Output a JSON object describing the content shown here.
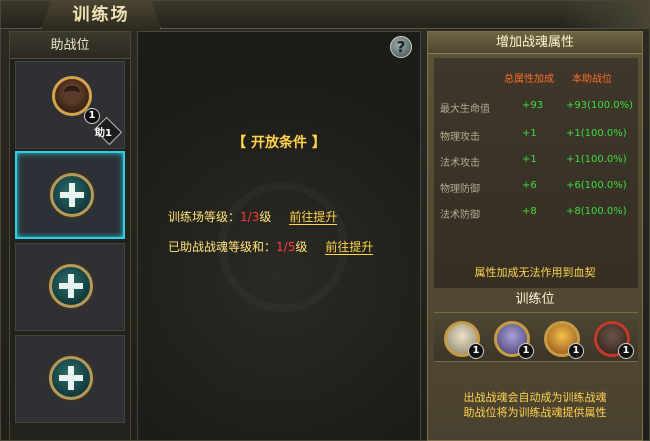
{
  "window": {
    "title": "训练场"
  },
  "left": {
    "header": "助战位",
    "slots": [
      {
        "type": "hero",
        "count": "1",
        "tag": "助1"
      },
      {
        "type": "empty"
      },
      {
        "type": "empty"
      },
      {
        "type": "empty"
      }
    ]
  },
  "middle": {
    "help_icon": "question-icon",
    "conditions_title": "【 开放条件 】",
    "rows": [
      {
        "label": "训练场等级：",
        "current": "1",
        "sep": "/",
        "required": "3",
        "unit": "级",
        "link": "前往提升"
      },
      {
        "label": "已助战战魂等级和：",
        "current": "1",
        "sep": "/",
        "required": "5",
        "unit": "级",
        "link": "前往提升"
      }
    ]
  },
  "right": {
    "header": "增加战魂属性",
    "col_total": "总属性加成",
    "col_own": "本助战位",
    "attrs": [
      {
        "name": "最大生命值",
        "total": "+93",
        "own": "+93(100.0%)"
      },
      {
        "name": "物理攻击",
        "total": "+1",
        "own": "+1(100.0%)"
      },
      {
        "name": "法术攻击",
        "total": "+1",
        "own": "+1(100.0%)"
      },
      {
        "name": "物理防御",
        "total": "+6",
        "own": "+6(100.0%)"
      },
      {
        "name": "法术防御",
        "total": "+8",
        "own": "+8(100.0%)"
      }
    ],
    "note": "属性加成无法作用到血契",
    "training_header": "训练位",
    "training_slots": [
      {
        "count": "1"
      },
      {
        "count": "1"
      },
      {
        "count": "1"
      },
      {
        "count": "1"
      }
    ],
    "footer_line1": "出战战魂会自动成为训练战魂",
    "footer_line2": "助战位将为训练战魂提供属性"
  },
  "colors": {
    "accent_cyan": "#2fd0e6",
    "gold": "#ffd24a",
    "green": "#3fdc3f",
    "red": "#ff3a3a"
  }
}
